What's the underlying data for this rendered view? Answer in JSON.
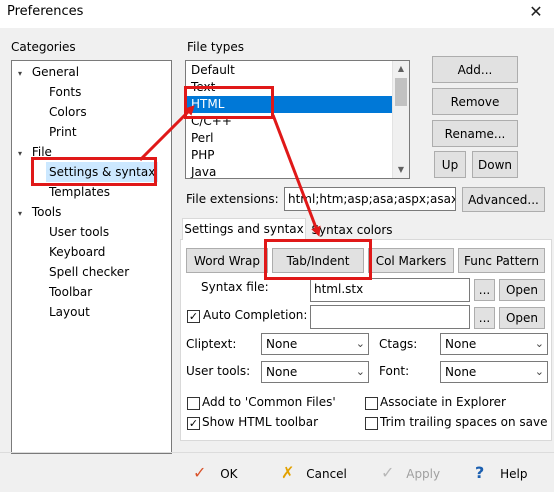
{
  "window": {
    "title": "Preferences",
    "close_glyph": "✕"
  },
  "categories": {
    "label": "Categories",
    "items": [
      {
        "label": "General",
        "toggle": "▾"
      },
      {
        "label": "Fonts"
      },
      {
        "label": "Colors"
      },
      {
        "label": "Print"
      },
      {
        "label": "File",
        "toggle": "▾"
      },
      {
        "label": "Settings & syntax"
      },
      {
        "label": "Templates"
      },
      {
        "label": "Tools",
        "toggle": "▾"
      },
      {
        "label": "User tools"
      },
      {
        "label": "Keyboard"
      },
      {
        "label": "Spell checker"
      },
      {
        "label": "Toolbar"
      },
      {
        "label": "Layout"
      }
    ]
  },
  "file_types": {
    "label": "File types",
    "items": [
      "Default",
      "Text",
      "HTML",
      "C/C++",
      "Perl",
      "PHP",
      "Java"
    ],
    "selected": "HTML",
    "scroll_up": "▲",
    "scroll_down": "▼"
  },
  "side_buttons": {
    "add": "Add...",
    "remove": "Remove",
    "rename": "Rename...",
    "up": "Up",
    "down": "Down",
    "advanced": "Advanced..."
  },
  "file_extensions": {
    "label": "File extensions:",
    "value": "html;htm;asp;asa;aspx;asax;s"
  },
  "tabs": [
    {
      "label": "Settings and syntax"
    },
    {
      "label": "Syntax colors"
    }
  ],
  "tab_buttons": {
    "word_wrap": "Word Wrap",
    "tab_indent": "Tab/Indent",
    "col_markers": "Col Markers",
    "func_pattern": "Func Pattern"
  },
  "syntax_file": {
    "label": "Syntax file:",
    "value": "html.stx",
    "browse": "...",
    "open": "Open"
  },
  "auto_completion": {
    "label": "Auto Completion:",
    "checked": "✓",
    "value": "",
    "browse": "...",
    "open": "Open"
  },
  "selects": {
    "cliptext": {
      "label": "Cliptext:",
      "value": "None"
    },
    "ctags": {
      "label": "Ctags:",
      "value": "None"
    },
    "user_tools": {
      "label": "User tools:",
      "value": "None"
    },
    "font": {
      "label": "Font:",
      "value": "None"
    },
    "chevron": "⌄"
  },
  "options": {
    "add_common": {
      "label": "Add to 'Common Files'",
      "checked": ""
    },
    "associate": {
      "label": "Associate in Explorer",
      "checked": ""
    },
    "show_toolbar": {
      "label": "Show HTML toolbar",
      "checked": "✓"
    },
    "trim_spaces": {
      "label": "Trim trailing spaces on save",
      "checked": ""
    }
  },
  "footer": {
    "ok": {
      "label": "OK",
      "icon": "✓"
    },
    "cancel": {
      "label": "Cancel",
      "icon": "✗"
    },
    "apply": {
      "label": "Apply",
      "icon": "✓"
    },
    "help": {
      "label": "Help",
      "icon": "?"
    }
  },
  "colors": {
    "selection": "#0078d7",
    "annotation": "#e01818"
  }
}
